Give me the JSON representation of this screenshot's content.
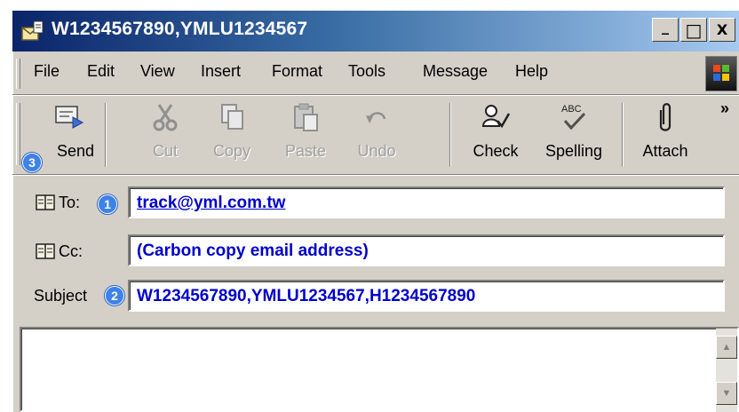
{
  "window": {
    "title": "W1234567890,YMLU1234567",
    "controls": [
      "_",
      "□",
      "X"
    ]
  },
  "menu": {
    "items": [
      "File",
      "Edit",
      "View",
      "Insert",
      "Format",
      "Tools",
      "Message",
      "Help"
    ]
  },
  "toolbar": {
    "buttons": [
      {
        "label": "Send",
        "icon": "send-icon",
        "enabled": true
      },
      {
        "label": "Cut",
        "icon": "scissors-icon",
        "enabled": false
      },
      {
        "label": "Copy",
        "icon": "copy-icon",
        "enabled": false
      },
      {
        "label": "Paste",
        "icon": "paste-icon",
        "enabled": false
      },
      {
        "label": "Undo",
        "icon": "undo-icon",
        "enabled": false
      },
      {
        "label": "Check",
        "icon": "check-names-icon",
        "enabled": true
      },
      {
        "label": "Spelling",
        "icon": "spelling-icon",
        "enabled": true
      },
      {
        "label": "Attach",
        "icon": "paperclip-icon",
        "enabled": true
      }
    ],
    "overflow": "»"
  },
  "badges": {
    "to": "1",
    "subject": "2",
    "send": "3"
  },
  "header": {
    "to_label": "To:",
    "to_value": "track@yml.com.tw",
    "cc_label": "Cc:",
    "cc_value": "(Carbon copy email address)",
    "subject_label": "Subject",
    "subject_value": "W1234567890,YMLU1234567,H1234567890"
  },
  "scrollbar": {
    "up": "▲",
    "down": "▼"
  },
  "colors": {
    "badge": "#3d82e8",
    "field_text": "#0000cc",
    "title_gradient_start": "#0a246a"
  }
}
